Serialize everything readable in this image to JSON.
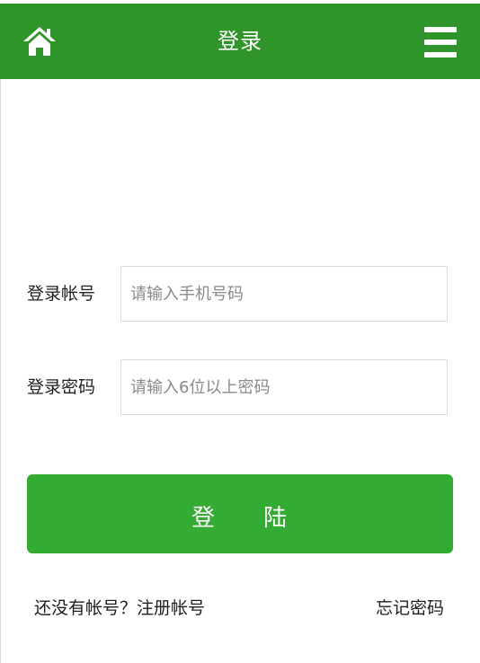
{
  "header": {
    "title": "登录",
    "home_icon": "home-icon",
    "menu_icon": "menu-icon",
    "background_color": "#2f9429"
  },
  "form": {
    "account": {
      "label": "登录帐号",
      "placeholder": "请输入手机号码",
      "value": ""
    },
    "password": {
      "label": "登录密码",
      "placeholder": "请输入6位以上密码",
      "value": ""
    },
    "submit": {
      "label_char_1": "登",
      "label_char_2": "陆",
      "color": "#34ab33"
    }
  },
  "links": {
    "register": "还没有帐号？注册帐号",
    "forgot": "忘记密码"
  }
}
